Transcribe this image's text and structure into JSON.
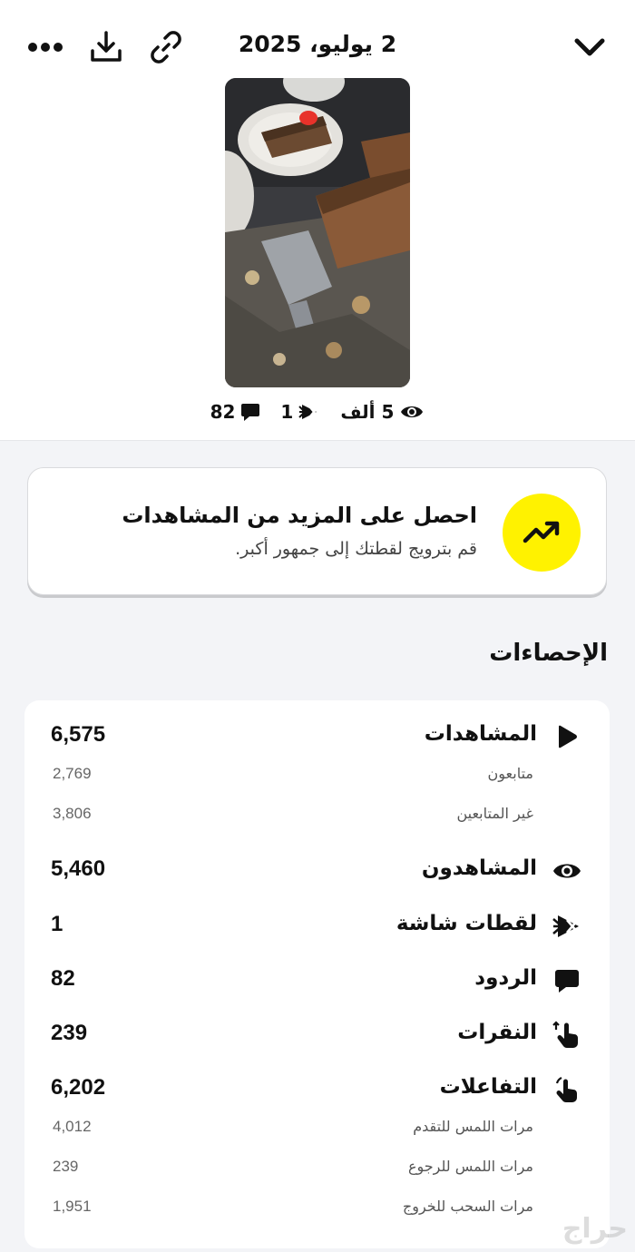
{
  "header": {
    "date": "2 يوليو، 2025",
    "icons": [
      "chevron-down-icon",
      "link-icon",
      "download-icon",
      "more-icon"
    ]
  },
  "snap_summary": {
    "views": "5 ألف",
    "screenshots": "1",
    "replies": "82"
  },
  "promo": {
    "title": "احصل على المزيد من المشاهدات",
    "subtitle": "قم بترويج لقطتك إلى جمهور أكبر.",
    "accent": "#fff200"
  },
  "stats": {
    "title": "الإحصاءات",
    "views": {
      "label": "المشاهدات",
      "value": "6,575"
    },
    "followers": {
      "label": "متابعون",
      "value": "2,769"
    },
    "non_followers": {
      "label": "غير المتابعين",
      "value": "3,806"
    },
    "viewers": {
      "label": "المشاهدون",
      "value": "5,460"
    },
    "screenshots": {
      "label": "لقطات شاشة",
      "value": "1"
    },
    "replies": {
      "label": "الردود",
      "value": "82"
    },
    "taps": {
      "label": "النقرات",
      "value": "239"
    },
    "interactions": {
      "label": "التفاعلات",
      "value": "6,202"
    },
    "forward_taps": {
      "label": "مرات اللمس للتقدم",
      "value": "4,012"
    },
    "back_taps": {
      "label": "مرات اللمس للرجوع",
      "value": "239"
    },
    "swipe_exits": {
      "label": "مرات السحب للخروج",
      "value": "1,951"
    }
  },
  "watermark": "حراج"
}
